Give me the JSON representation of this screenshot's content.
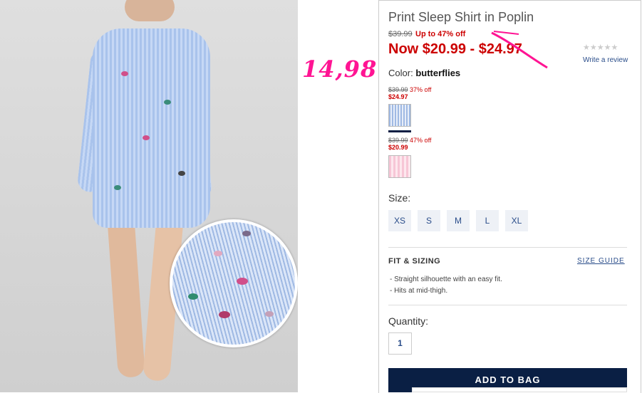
{
  "product": {
    "title": "Print Sleep Shirt in Poplin",
    "original_price": "$39.99",
    "discount": "Up to 47% off",
    "now_price": "Now $20.99 - $24.97",
    "rating_stars": "★★★★★",
    "review_link": "Write a review",
    "color_label": "Color:",
    "color_name": "butterflies"
  },
  "annotation": {
    "handwritten_price": "14,98",
    "strike_color": "#ff1493"
  },
  "swatches": [
    {
      "original": "$39.99",
      "percent": "37% off",
      "price": "$24.97",
      "selected": true
    },
    {
      "original": "$39.99",
      "percent": "47% off",
      "price": "$20.99",
      "selected": false
    }
  ],
  "sizes": {
    "label": "Size:",
    "options": [
      "XS",
      "S",
      "M",
      "L",
      "XL"
    ]
  },
  "fit": {
    "heading": "FIT & SIZING",
    "guide_link": "SIZE GUIDE",
    "bullets": [
      "- Straight silhouette with an easy fit.",
      "- Hits at mid-thigh."
    ]
  },
  "quantity": {
    "label": "Quantity:",
    "value": "1"
  },
  "cart": {
    "add_label": "ADD TO BAG"
  },
  "colors": {
    "sale_red": "#cc0000",
    "navy": "#0a1f44",
    "link_blue": "#2a4d8a"
  }
}
